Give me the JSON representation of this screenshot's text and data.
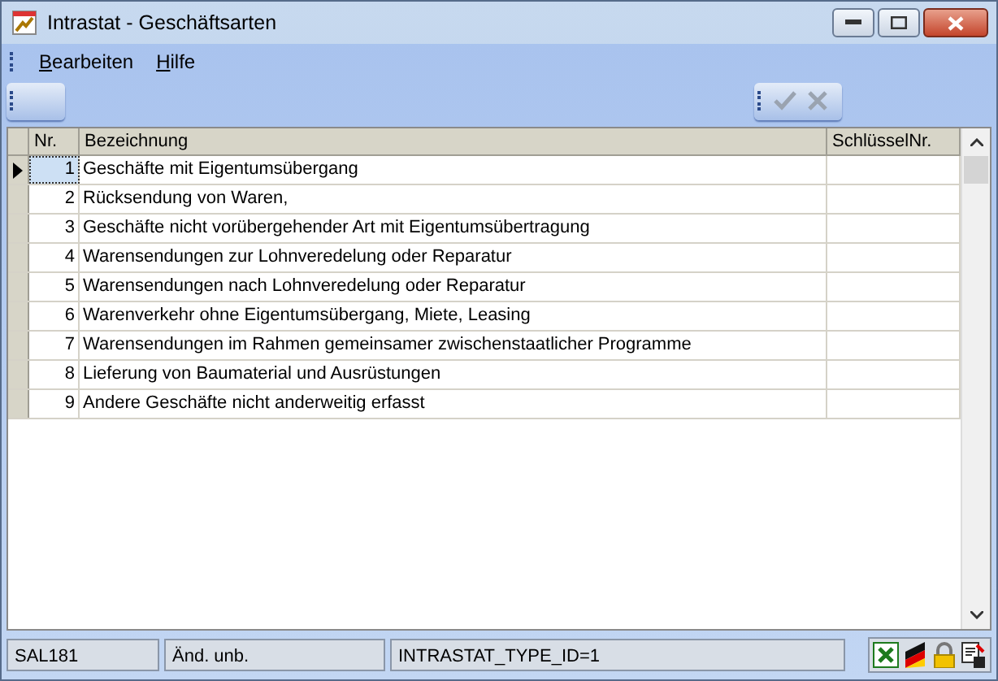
{
  "window": {
    "title": "Intrastat - Geschäftsarten"
  },
  "menu": [
    {
      "label": "Bearbeiten"
    },
    {
      "label": "Hilfe"
    }
  ],
  "toolbar": {
    "buttons": [
      {
        "kind": "check",
        "disabled": true
      },
      {
        "kind": "cancel",
        "disabled": true
      }
    ]
  },
  "table": {
    "columns": [
      "Nr.",
      "Bezeichnung",
      "SchlüsselNr."
    ],
    "rows": [
      {
        "nr": "1",
        "name": "Geschäfte mit Eigentumsübergang",
        "selected": true
      },
      {
        "nr": "2",
        "name": "Rücksendung von Waren,",
        "selected": false
      },
      {
        "nr": "3",
        "name": "Geschäfte nicht vorübergehender Art mit Eigentumsübertragung",
        "selected": false
      },
      {
        "nr": "4",
        "name": "Warensendungen zur Lohnveredelung oder Reparatur",
        "selected": false
      },
      {
        "nr": "5",
        "name": "Warensendungen nach Lohnveredelung oder Reparatur",
        "selected": false
      },
      {
        "nr": "6",
        "name": "Warenverkehr ohne Eigentumsübergang, Miete, Leasing",
        "selected": false
      },
      {
        "nr": "7",
        "name": "Warensendungen im Rahmen gemeinsamer zwischenstaatlicher Programme",
        "selected": false
      },
      {
        "nr": "8",
        "name": "Lieferung von Baumaterial und Ausrüstungen",
        "selected": false
      },
      {
        "nr": "9",
        "name": "Andere Geschäfte nicht anderweitig erfasst",
        "selected": false
      }
    ]
  },
  "status_bar": [
    "SAL181",
    "Änd. unb.",
    "INTRASTAT_TYPE_ID=1"
  ]
}
